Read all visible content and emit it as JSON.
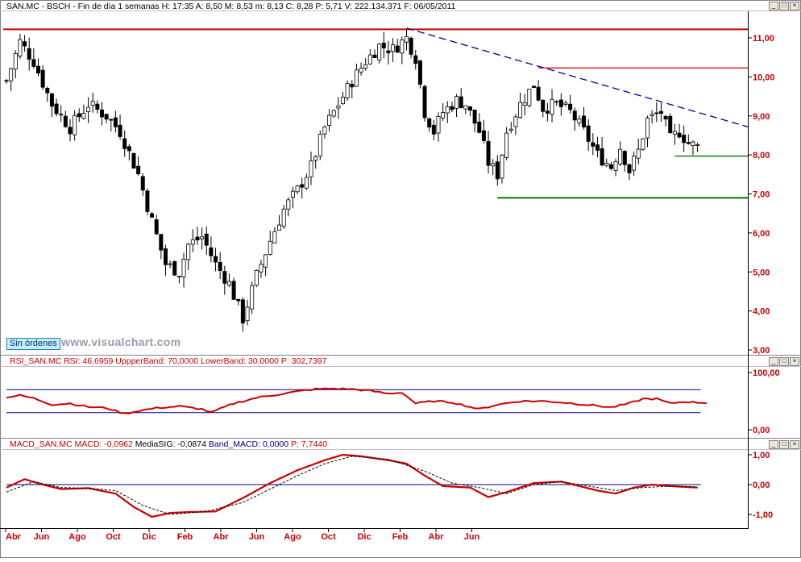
{
  "price_header": {
    "text": "SAN.MC - BSCH - Fin de día 1 semanas  H: 17:35  A: 8,50  M: 8,53  m: 8,13  C: 8,28  P: 5,71  V: 222.134.371  F: 06/05/2011"
  },
  "badge": "Sin órdenes",
  "watermark": "www.visualchart.com",
  "rsi_header": {
    "text": "RSI_SAN.MC  RSI: 46,6959  UppperBand: 70,0000  LowerBand: 30,0000  P: 302,7397",
    "color": "#cc0000"
  },
  "macd_header": {
    "parts": [
      {
        "t": "MACD_SAN.MC  MACD: -0,0962 ",
        "c": "#cc0000"
      },
      {
        "t": " MediaSIG: -0,0874 ",
        "c": "#000000"
      },
      {
        "t": " Band_MACD: 0,0000 ",
        "c": "#000080"
      },
      {
        "t": " P: 7,7440",
        "c": "#cc0000"
      }
    ]
  },
  "window_buttons": [
    "minimize-button",
    "maximize-button",
    "close-button"
  ],
  "colors": {
    "axis_text": "#cc0000",
    "resistance": "#cc0000",
    "support": "#007700",
    "trend": "#000099",
    "rsi_line": "#cc0000",
    "rsi_bands": "#000080",
    "macd_line": "#cc0000",
    "signal_line": "#000000"
  },
  "chart_data": [
    {
      "type": "candlestick",
      "title": "SAN.MC - BSCH",
      "interval": "weekly",
      "y_ticks": [
        "11,00",
        "10,00",
        "9,00",
        "8,00",
        "7,00",
        "6,00",
        "5,00",
        "4,00",
        "3,00"
      ],
      "y_range": [
        3.0,
        11.0
      ],
      "x_tick_labels": [
        "Abr",
        "Jun",
        "Ago",
        "Oct",
        "Dic",
        "Feb",
        "Abr",
        "Jun",
        "Ago",
        "Oct",
        "Dic",
        "Feb",
        "Abr",
        "Jun"
      ],
      "close_path": [
        [
          0,
          9.9
        ],
        [
          3,
          10.9
        ],
        [
          6,
          10.4
        ],
        [
          10,
          9.3
        ],
        [
          14,
          8.7
        ],
        [
          18,
          9.3
        ],
        [
          22,
          9.0
        ],
        [
          25,
          8.6
        ],
        [
          29,
          7.5
        ],
        [
          32,
          6.3
        ],
        [
          35,
          5.2
        ],
        [
          38,
          5.0
        ],
        [
          40,
          5.7
        ],
        [
          43,
          5.9
        ],
        [
          46,
          5.2
        ],
        [
          49,
          4.7
        ],
        [
          52,
          3.8
        ],
        [
          55,
          4.9
        ],
        [
          58,
          5.8
        ],
        [
          61,
          6.6
        ],
        [
          64,
          7.1
        ],
        [
          67,
          7.7
        ],
        [
          70,
          8.7
        ],
        [
          73,
          9.3
        ],
        [
          76,
          9.9
        ],
        [
          79,
          10.4
        ],
        [
          82,
          10.8
        ],
        [
          85,
          10.7
        ],
        [
          88,
          11.0
        ],
        [
          90,
          10.5
        ],
        [
          92,
          9.1
        ],
        [
          94,
          8.6
        ],
        [
          96,
          9.1
        ],
        [
          99,
          9.4
        ],
        [
          101,
          9.3
        ],
        [
          104,
          8.6
        ],
        [
          106,
          7.8
        ],
        [
          108,
          7.5
        ],
        [
          110,
          8.6
        ],
        [
          113,
          9.3
        ],
        [
          116,
          9.8
        ],
        [
          118,
          9.2
        ],
        [
          121,
          9.3
        ],
        [
          124,
          9.1
        ],
        [
          127,
          8.6
        ],
        [
          130,
          8.0
        ],
        [
          133,
          7.7
        ],
        [
          135,
          8.2
        ],
        [
          137,
          7.6
        ],
        [
          139,
          8.1
        ],
        [
          141,
          8.9
        ],
        [
          144,
          9.1
        ],
        [
          146,
          8.4
        ],
        [
          148,
          8.6
        ],
        [
          150,
          8.3
        ],
        [
          152,
          8.2
        ]
      ],
      "horizontal_lines": [
        {
          "name": "resistance-high",
          "y": 11.22
        },
        {
          "name": "resistance-mid",
          "y": 10.23,
          "x_from": 117
        },
        {
          "name": "support-low",
          "y": 6.9,
          "x_from": 108
        },
        {
          "name": "support-recent",
          "y": 7.97,
          "x_from": 147
        }
      ],
      "trend_line": {
        "from": [
          88,
          11.25
        ],
        "to": [
          160,
          8.72
        ]
      }
    },
    {
      "type": "line",
      "title": "RSI_SAN.MC",
      "y_ticks": [
        "100,00",
        "0,00"
      ],
      "bands": [
        70.0,
        30.0
      ],
      "series": [
        {
          "name": "RSI",
          "points": [
            [
              0,
              57
            ],
            [
              3,
              60
            ],
            [
              6,
              55
            ],
            [
              10,
              44
            ],
            [
              14,
              46
            ],
            [
              18,
              40
            ],
            [
              22,
              38
            ],
            [
              26,
              28
            ],
            [
              29,
              33
            ],
            [
              33,
              38
            ],
            [
              38,
              41
            ],
            [
              43,
              36
            ],
            [
              45,
              30
            ],
            [
              50,
              46
            ],
            [
              55,
              56
            ],
            [
              60,
              62
            ],
            [
              64,
              67
            ],
            [
              68,
              71
            ],
            [
              72,
              72
            ],
            [
              76,
              71
            ],
            [
              80,
              68
            ],
            [
              84,
              63
            ],
            [
              87,
              65
            ],
            [
              90,
              46
            ],
            [
              94,
              50
            ],
            [
              98,
              48
            ],
            [
              101,
              42
            ],
            [
              104,
              36
            ],
            [
              108,
              44
            ],
            [
              113,
              50
            ],
            [
              118,
              50
            ],
            [
              122,
              48
            ],
            [
              126,
              45
            ],
            [
              130,
              42
            ],
            [
              133,
              39
            ],
            [
              137,
              46
            ],
            [
              140,
              54
            ],
            [
              143,
              54
            ],
            [
              146,
              46
            ],
            [
              149,
              49
            ],
            [
              154,
              47
            ]
          ]
        }
      ]
    },
    {
      "type": "line",
      "title": "MACD_SAN.MC",
      "y_ticks": [
        "1,00",
        "0,00",
        "-1,00"
      ],
      "band": 0.0,
      "series": [
        {
          "name": "MACD",
          "points": [
            [
              0,
              -0.1
            ],
            [
              4,
              0.18
            ],
            [
              8,
              0.0
            ],
            [
              12,
              -0.15
            ],
            [
              18,
              -0.12
            ],
            [
              24,
              -0.3
            ],
            [
              28,
              -0.75
            ],
            [
              32,
              -1.08
            ],
            [
              36,
              -0.95
            ],
            [
              40,
              -0.92
            ],
            [
              46,
              -0.9
            ],
            [
              52,
              -0.45
            ],
            [
              58,
              0.05
            ],
            [
              64,
              0.48
            ],
            [
              70,
              0.82
            ],
            [
              74,
              1.0
            ],
            [
              78,
              0.95
            ],
            [
              84,
              0.82
            ],
            [
              88,
              0.7
            ],
            [
              92,
              0.3
            ],
            [
              96,
              -0.05
            ],
            [
              102,
              -0.1
            ],
            [
              106,
              -0.42
            ],
            [
              110,
              -0.25
            ],
            [
              116,
              0.05
            ],
            [
              122,
              0.1
            ],
            [
              126,
              -0.05
            ],
            [
              130,
              -0.2
            ],
            [
              134,
              -0.3
            ],
            [
              138,
              -0.1
            ],
            [
              142,
              0.0
            ],
            [
              146,
              -0.05
            ],
            [
              152,
              -0.1
            ]
          ]
        },
        {
          "name": "MediaSIG",
          "points": [
            [
              0,
              -0.25
            ],
            [
              6,
              0.1
            ],
            [
              12,
              -0.1
            ],
            [
              18,
              -0.12
            ],
            [
              24,
              -0.2
            ],
            [
              30,
              -0.7
            ],
            [
              36,
              -1.0
            ],
            [
              44,
              -0.9
            ],
            [
              52,
              -0.6
            ],
            [
              58,
              -0.15
            ],
            [
              64,
              0.3
            ],
            [
              70,
              0.7
            ],
            [
              76,
              0.95
            ],
            [
              84,
              0.85
            ],
            [
              92,
              0.45
            ],
            [
              98,
              0.05
            ],
            [
              104,
              -0.1
            ],
            [
              110,
              -0.3
            ],
            [
              116,
              0.0
            ],
            [
              122,
              0.1
            ],
            [
              128,
              -0.05
            ],
            [
              134,
              -0.2
            ],
            [
              140,
              -0.1
            ],
            [
              146,
              -0.05
            ],
            [
              152,
              -0.08
            ]
          ]
        }
      ]
    }
  ]
}
